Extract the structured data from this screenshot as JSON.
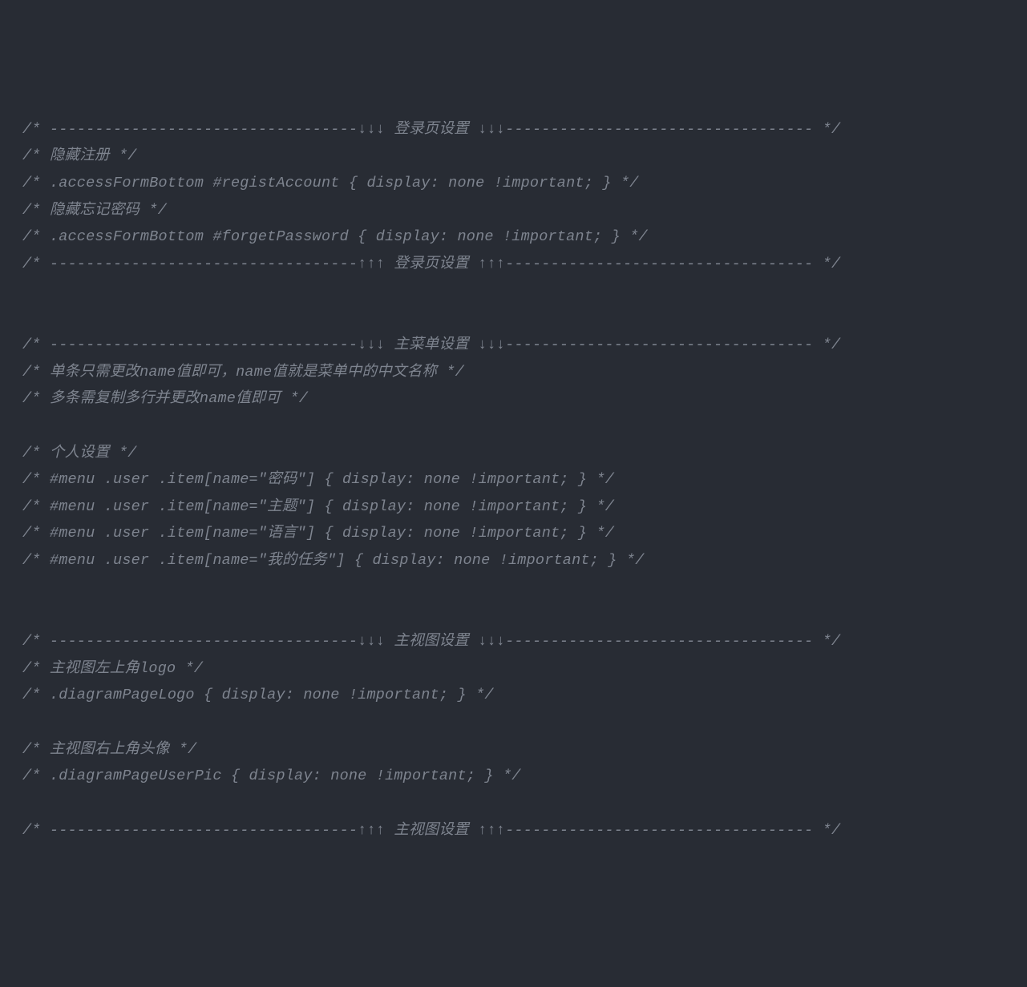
{
  "lines": [
    "/* ----------------------------------↓↓↓ 登录页设置 ↓↓↓---------------------------------- */",
    "/* 隐藏注册 */",
    "/* .accessFormBottom #registAccount { display: none !important; } */",
    "/* 隐藏忘记密码 */",
    "/* .accessFormBottom #forgetPassword { display: none !important; } */",
    "/* ----------------------------------↑↑↑ 登录页设置 ↑↑↑---------------------------------- */",
    "",
    "",
    "/* ----------------------------------↓↓↓ 主菜单设置 ↓↓↓---------------------------------- */",
    "/* 单条只需更改name值即可，name值就是菜单中的中文名称 */",
    "/* 多条需复制多行并更改name值即可 */",
    "",
    "/* 个人设置 */",
    "/* #menu .user .item[name=\"密码\"] { display: none !important; } */",
    "/* #menu .user .item[name=\"主题\"] { display: none !important; } */",
    "/* #menu .user .item[name=\"语言\"] { display: none !important; } */",
    "/* #menu .user .item[name=\"我的任务\"] { display: none !important; } */",
    "",
    "",
    "/* ----------------------------------↓↓↓ 主视图设置 ↓↓↓---------------------------------- */",
    "/* 主视图左上角logo */",
    "/* .diagramPageLogo { display: none !important; } */",
    "",
    "/* 主视图右上角头像 */",
    "/* .diagramPageUserPic { display: none !important; } */",
    "",
    "/* ----------------------------------↑↑↑ 主视图设置 ↑↑↑---------------------------------- */"
  ]
}
